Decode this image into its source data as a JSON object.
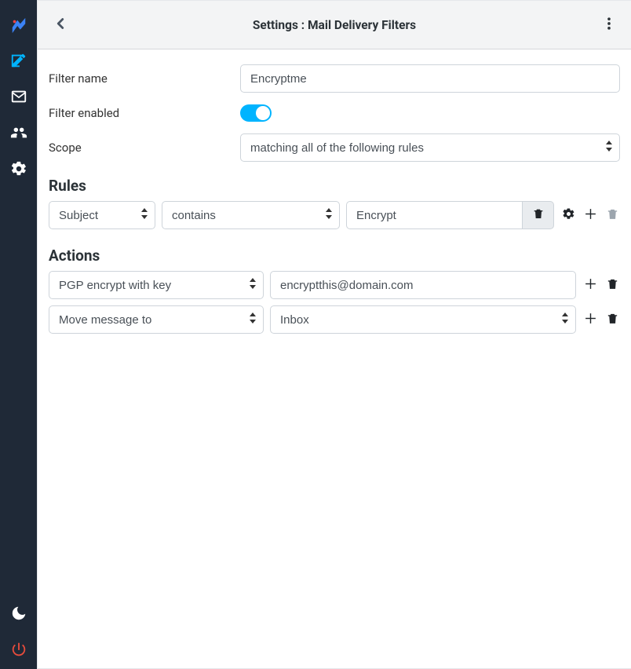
{
  "header": {
    "title": "Settings : Mail Delivery Filters"
  },
  "form": {
    "filter_name_label": "Filter name",
    "filter_name_value": "Encryptme",
    "filter_enabled_label": "Filter enabled",
    "filter_enabled": true,
    "scope_label": "Scope",
    "scope_value": "matching all of the following rules"
  },
  "sections": {
    "rules_title": "Rules",
    "actions_title": "Actions"
  },
  "rules": [
    {
      "field": "Subject",
      "operator": "contains",
      "value": "Encrypt"
    }
  ],
  "actions": [
    {
      "type": "PGP encrypt with key",
      "param": "encryptthis@domain.com",
      "param_kind": "text"
    },
    {
      "type": "Move message to",
      "param": "Inbox",
      "param_kind": "select"
    }
  ],
  "sidebar": {
    "items": [
      "logo",
      "compose",
      "mail",
      "contacts",
      "settings"
    ],
    "bottom": [
      "dark-mode",
      "power"
    ]
  }
}
